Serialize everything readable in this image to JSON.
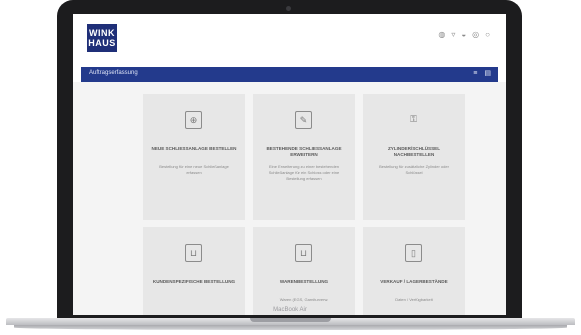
{
  "app": {
    "logo_text": "WINK HAUS"
  },
  "topbar": {
    "icons": [
      "globe-icon",
      "cart-icon",
      "user-icon",
      "help-icon",
      "logout-icon"
    ]
  },
  "navbar": {
    "title": "Auftragserfassung",
    "icons": [
      "menu-icon",
      "list-icon"
    ]
  },
  "cards": [
    {
      "icon": "key-plus-icon",
      "title": "Neue Schließanlage bestellen",
      "description": "Bestellung für eine neue Schließanlage erfassen"
    },
    {
      "icon": "key-edit-icon",
      "title": "Bestehende Schließanlage erweitern",
      "description": "Eine Erweiterung zu einer bestehenden Schließanlage für ein Schloss oder eine Bestellung erfassen"
    },
    {
      "icon": "cylinder-key-icon",
      "title": "Zylinder/Schlüssel nachbestellen",
      "description": "Bestellung für zusätzliche Zylinder oder Schlüssel"
    },
    {
      "icon": "basket-icon",
      "title": "Kundenspezifische Bestellung",
      "description": ""
    },
    {
      "icon": "basket-icon",
      "title": "Warenbestellung",
      "description": "Waren (EGS, Garniturverw."
    },
    {
      "icon": "phone-icon",
      "title": "Verkauf / Lagerbestände",
      "description": "Daten / Verfügbarkeit"
    }
  ],
  "device": {
    "brand": "MacBook Air"
  }
}
